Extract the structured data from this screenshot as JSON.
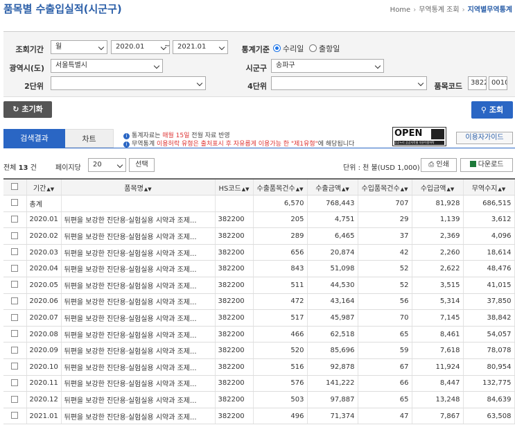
{
  "header": {
    "title": "품목별 수출입실적(시군구)",
    "breadcrumb": [
      "Home",
      "무역통계 조회",
      "지역별무역통계"
    ]
  },
  "filter": {
    "period_label": "조회기간",
    "period_unit": "월",
    "period_from": "2020.01",
    "period_tilde": "~",
    "period_to": "2021.01",
    "basis_label": "통계기준",
    "basis_options": [
      "수리일",
      "출항일"
    ],
    "basis_selected": "수리일",
    "province_label": "광역시(도)",
    "province_value": "서울특별시",
    "district_label": "시군구",
    "district_value": "송파구",
    "unit2_label": "2단위",
    "unit2_value": "",
    "unit4_label": "4단위",
    "unit4_value": "",
    "code_label": "품목코드",
    "code_value1": "3822",
    "code_value2": "0010"
  },
  "buttons": {
    "reset": "초기화",
    "search": "조회",
    "select": "선택",
    "print": "인쇄",
    "download": "다운로드",
    "guide": "이용자가이드"
  },
  "tabs": [
    "검색결과",
    "차트"
  ],
  "notices": {
    "n1_pre": "통계자료는 ",
    "n1_red": "매월 15일",
    "n1_post": " 전월 자료 반영",
    "n2_pre": "무역통계 ",
    "n2_red": "이용허락 유형은 출처표시 후 자유롭게 이용가능 한 \"제1유형\"",
    "n2_post": "에 해당됩니다"
  },
  "open_logo": {
    "big": "OPEN",
    "small": "공공누리 공공저작물 자유이용허락"
  },
  "summary": {
    "total_pre": "전체",
    "total_count": "13",
    "total_post": "건",
    "per_page_label": "페이지당",
    "per_page": "20",
    "unit": "단위 : 천 불(USD 1,000)"
  },
  "table": {
    "headers": [
      "기간",
      "품목명",
      "HS코드",
      "수출품목건수",
      "수출금액",
      "수입품목건수",
      "수입금액",
      "무역수지"
    ],
    "total": {
      "label": "총계",
      "export_count": "6,570",
      "export_amount": "768,443",
      "import_count": "707",
      "import_amount": "81,928",
      "balance": "686,515"
    },
    "rows": [
      {
        "period": "2020.01",
        "name": "뒤편을 보강한 진단용·실험실용 시약과 조제...",
        "hs": "382200",
        "ec": "205",
        "ea": "4,751",
        "ic": "29",
        "ia": "1,139",
        "bal": "3,612"
      },
      {
        "period": "2020.02",
        "name": "뒤편을 보강한 진단용·실험실용 시약과 조제...",
        "hs": "382200",
        "ec": "289",
        "ea": "6,465",
        "ic": "37",
        "ia": "2,369",
        "bal": "4,096"
      },
      {
        "period": "2020.03",
        "name": "뒤편을 보강한 진단용·실험실용 시약과 조제...",
        "hs": "382200",
        "ec": "656",
        "ea": "20,874",
        "ic": "42",
        "ia": "2,260",
        "bal": "18,614"
      },
      {
        "period": "2020.04",
        "name": "뒤편을 보강한 진단용·실험실용 시약과 조제...",
        "hs": "382200",
        "ec": "843",
        "ea": "51,098",
        "ic": "52",
        "ia": "2,622",
        "bal": "48,476"
      },
      {
        "period": "2020.05",
        "name": "뒤편을 보강한 진단용·실험실용 시약과 조제...",
        "hs": "382200",
        "ec": "511",
        "ea": "44,530",
        "ic": "52",
        "ia": "3,515",
        "bal": "41,015"
      },
      {
        "period": "2020.06",
        "name": "뒤편을 보강한 진단용·실험실용 시약과 조제...",
        "hs": "382200",
        "ec": "472",
        "ea": "43,164",
        "ic": "56",
        "ia": "5,314",
        "bal": "37,850"
      },
      {
        "period": "2020.07",
        "name": "뒤편을 보강한 진단용·실험실용 시약과 조제...",
        "hs": "382200",
        "ec": "517",
        "ea": "45,987",
        "ic": "70",
        "ia": "7,145",
        "bal": "38,842"
      },
      {
        "period": "2020.08",
        "name": "뒤편을 보강한 진단용·실험실용 시약과 조제...",
        "hs": "382200",
        "ec": "466",
        "ea": "62,518",
        "ic": "65",
        "ia": "8,461",
        "bal": "54,057"
      },
      {
        "period": "2020.09",
        "name": "뒤편을 보강한 진단용·실험실용 시약과 조제...",
        "hs": "382200",
        "ec": "520",
        "ea": "85,696",
        "ic": "59",
        "ia": "7,618",
        "bal": "78,078"
      },
      {
        "period": "2020.10",
        "name": "뒤편을 보강한 진단용·실험실용 시약과 조제...",
        "hs": "382200",
        "ec": "516",
        "ea": "92,878",
        "ic": "67",
        "ia": "11,924",
        "bal": "80,954"
      },
      {
        "period": "2020.11",
        "name": "뒤편을 보강한 진단용·실험실용 시약과 조제...",
        "hs": "382200",
        "ec": "576",
        "ea": "141,222",
        "ic": "66",
        "ia": "8,447",
        "bal": "132,775"
      },
      {
        "period": "2020.12",
        "name": "뒤편을 보강한 진단용·실험실용 시약과 조제...",
        "hs": "382200",
        "ec": "503",
        "ea": "97,887",
        "ic": "65",
        "ia": "13,248",
        "bal": "84,639"
      },
      {
        "period": "2021.01",
        "name": "뒤편을 보강한 진단용·실험실용 시약과 조제...",
        "hs": "382200",
        "ec": "496",
        "ea": "71,374",
        "ic": "47",
        "ia": "7,867",
        "bal": "63,508"
      }
    ]
  },
  "icons": {
    "sort": "sort-updown-icon",
    "reset": "refresh-icon",
    "search": "magnifier-icon",
    "print": "printer-icon",
    "download": "excel-icon",
    "info": "info-icon",
    "dropdown": "chevron-down-icon"
  },
  "colors": {
    "accent": "#2a66c4",
    "title": "#2a5ea8",
    "notice_red": "#dd3333"
  }
}
